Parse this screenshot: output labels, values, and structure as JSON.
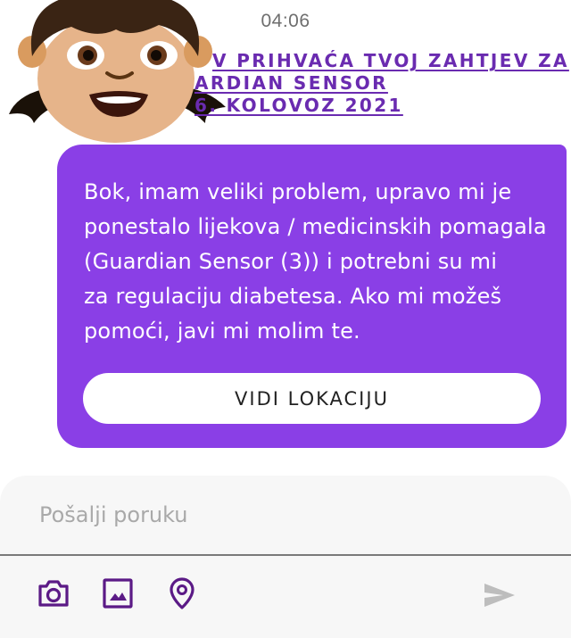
{
  "status_bar": {
    "time": "04:06"
  },
  "request_header": {
    "line1": "V PRIHVAĆA TVOJ ZAHTJEV ZA",
    "line2": "ARDIAN SENSOR",
    "line3": "6. KOLOVOZ 2021"
  },
  "message": {
    "lines": [
      "Bok, imam veliki problem, upravo mi je",
      "ponestalo lijekova / medicinskih pomagala",
      "(Guardian Sensor (3)) i potrebni su mi",
      "za regulaciju diabetesa. Ako mi možeš",
      "pomoći, javi mi molim te."
    ],
    "location_button": "VIDI LOKACIJU"
  },
  "composer": {
    "placeholder": "Pošalji poruku",
    "value": "",
    "icons": [
      "camera-icon",
      "image-icon",
      "location-pin-icon",
      "send-icon"
    ]
  },
  "colors": {
    "bubble": "#8a3fe6",
    "header_text": "#6a2bb0",
    "icon_accent": "#5b1a86",
    "send_disabled": "#bdbdbd"
  }
}
